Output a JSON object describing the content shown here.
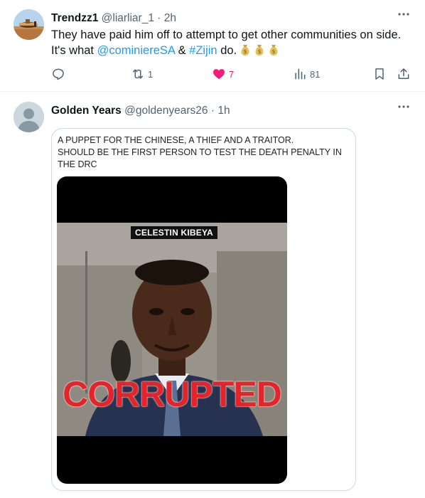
{
  "tweet1": {
    "display_name": "Trendzz1",
    "handle": "@liarliar_1",
    "separator": "·",
    "time": "2h",
    "text_before": "They have paid him off to attempt to get other communities on side. It's what ",
    "mention": "@cominiereSA",
    "text_middle": " & ",
    "hashtag": "#Zijin",
    "text_after": " do.",
    "emoji_name": "money-bag-icon",
    "emoji_count": 3,
    "reply_count": "",
    "retweet_count": "1",
    "like_count": "7",
    "view_count": "81",
    "liked": true
  },
  "tweet2": {
    "display_name": "Golden Years",
    "handle": "@goldenyears26",
    "separator": "·",
    "time": "1h",
    "quote": {
      "text_line1": "A PUPPET FOR THE CHINESE, A THIEF AND A TRAITOR.",
      "text_line2": "SHOULD BE THE FIRST PERSON TO TEST THE DEATH PENALTY IN THE DRC",
      "image_caption": "CELESTIN KIBEYA",
      "image_overlay": "CORRUPTED"
    }
  },
  "colors": {
    "link": "#1d9bf0",
    "like": "#f91880",
    "muted": "#536471",
    "overlay_red": "#e3242b"
  },
  "icons": {
    "more": "more-dots-icon",
    "reply": "reply-icon",
    "retweet": "retweet-icon",
    "like": "heart-icon",
    "views": "views-chart-icon",
    "bookmark": "bookmark-icon",
    "share": "share-icon"
  }
}
